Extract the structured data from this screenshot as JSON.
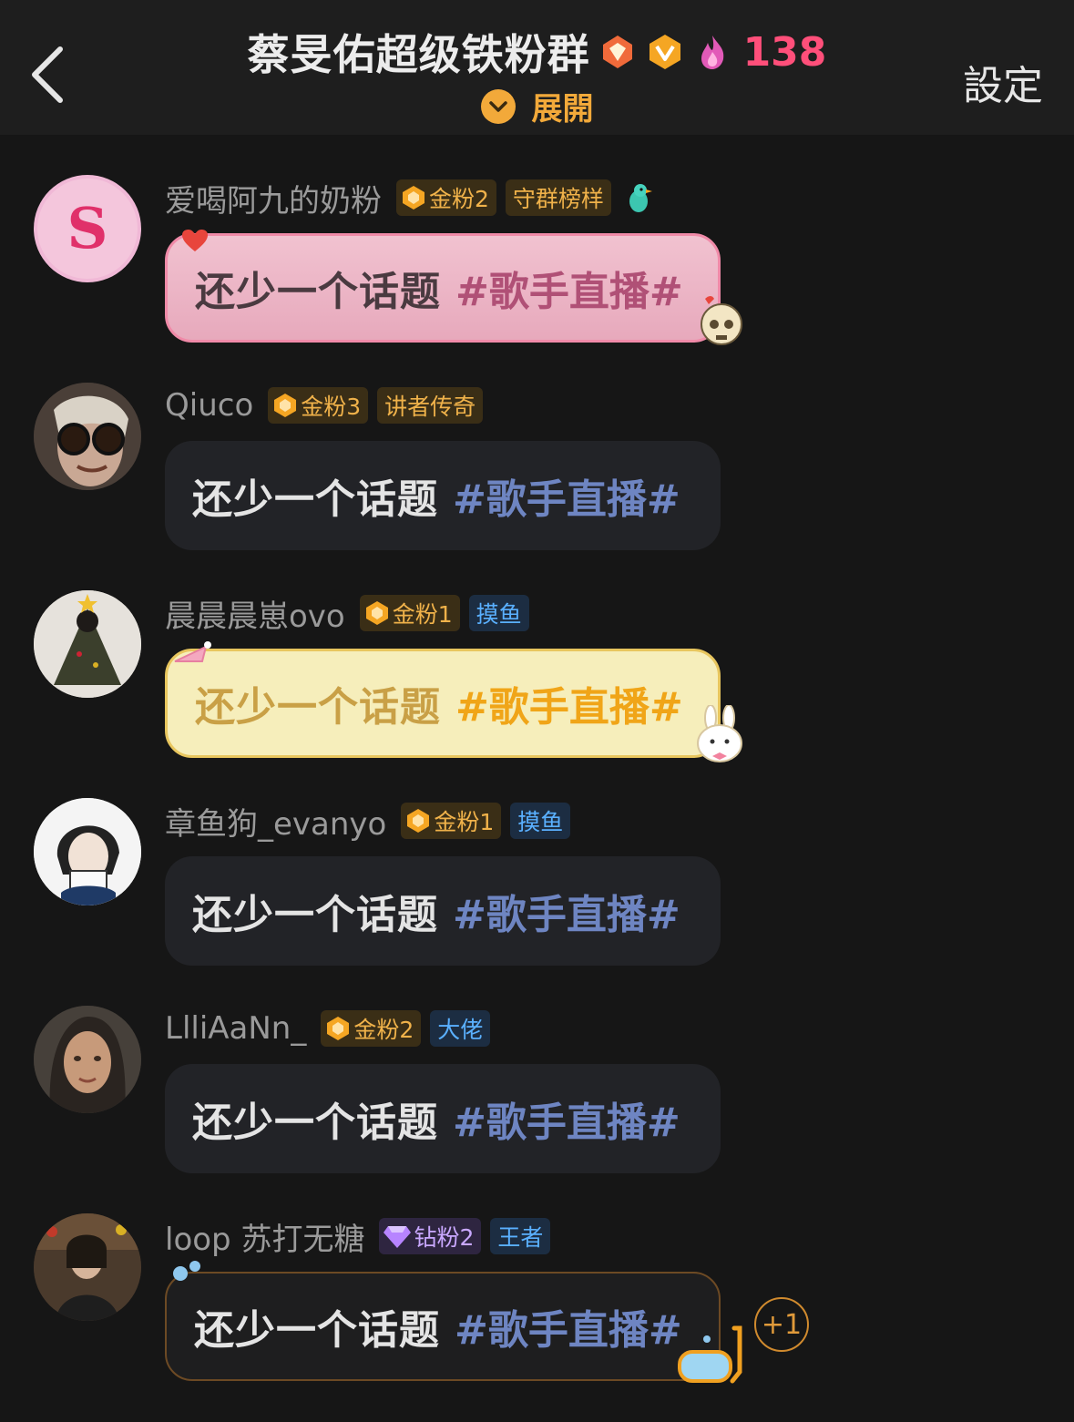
{
  "header": {
    "title": "蔡旻佑超级铁粉群",
    "online_count": "138",
    "expand_label": "展開",
    "settings_label": "設定"
  },
  "messages": [
    {
      "username": "爱喝阿九的奶粉",
      "fan_level": "金粉2",
      "title_badge": "守群榜样",
      "text": "还少一个话题",
      "topic": "#歌手直播#"
    },
    {
      "username": "Qiuco",
      "fan_level": "金粉3",
      "title_badge": "讲者传奇",
      "text": "还少一个话题",
      "topic": "#歌手直播#"
    },
    {
      "username": "晨晨晨崽ovo",
      "fan_level": "金粉1",
      "title_badge": "摸鱼",
      "text": "还少一个话题",
      "topic": "#歌手直播#"
    },
    {
      "username": "章鱼狗_evanyo",
      "fan_level": "金粉1",
      "title_badge": "摸鱼",
      "text": "还少一个话题",
      "topic": "#歌手直播#"
    },
    {
      "username": "LlliAaNn_",
      "fan_level": "金粉2",
      "title_badge": "大佬",
      "text": "还少一个话题",
      "topic": "#歌手直播#"
    },
    {
      "username": "loop 苏打无糖",
      "fan_level": "钻粉2",
      "title_badge": "王者",
      "text": "还少一个话题",
      "topic": "#歌手直播#"
    }
  ],
  "reaction": {
    "label": "+1"
  },
  "colors": {
    "accent": "#f2a93a",
    "online": "#ff4f7a",
    "topic": "#6e85c2",
    "background": "#161616"
  }
}
